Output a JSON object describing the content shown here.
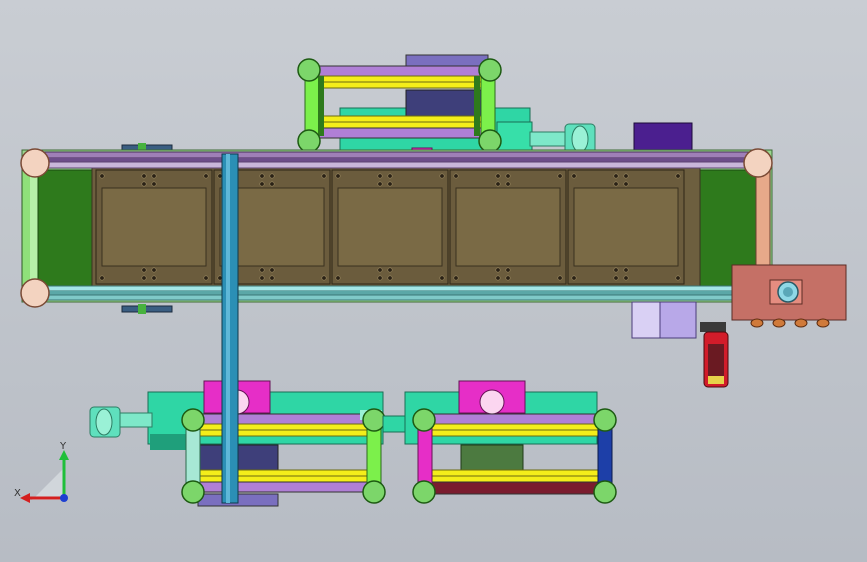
{
  "viewport": {
    "background_top": "#c9cdd3",
    "background_bottom": "#b7bcc4"
  },
  "triad": {
    "x_label": "X",
    "y_label": "Y",
    "x_color": "#d41f1f",
    "y_color": "#1fbf3a",
    "z_color": "#1d3fd1"
  },
  "model": {
    "conveyor": {
      "belt_color": "#7a6a45",
      "rail_color": "#8a6e9c",
      "rail_lower_color": "#7fc9c8",
      "end_block_color": "#2e7a1c",
      "pallet_count": 5
    },
    "accent_colors": {
      "yellow": "#f4ee1a",
      "green_frame": "#46c83a",
      "teal": "#2fd6a5",
      "magenta": "#e62ec7",
      "purple": "#4b1f8f",
      "salmon": "#c57066",
      "steel_blue": "#2b8fb5"
    }
  }
}
